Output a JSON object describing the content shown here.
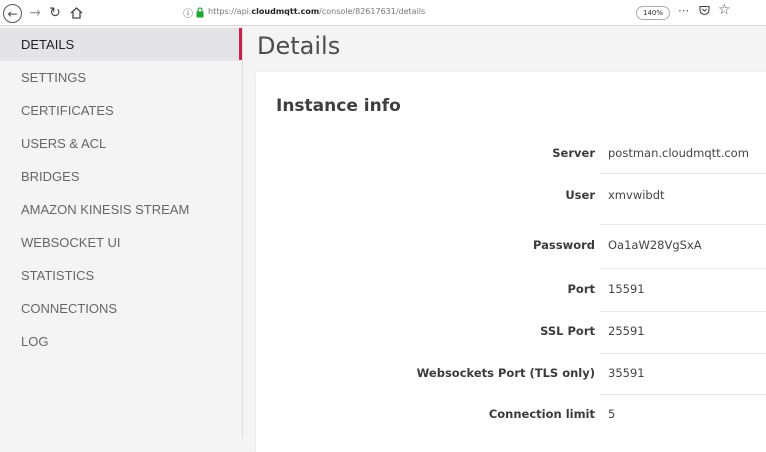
{
  "browser": {
    "url_prefix": "https://api.",
    "url_domain": "cloudmqtt.com",
    "url_path": "/console/82617631/details",
    "zoom": "140%",
    "icons": [
      "back-icon",
      "forward-icon",
      "reload-icon",
      "home-icon",
      "info-icon",
      "lock-icon",
      "more-icon",
      "pocket-icon",
      "star-icon"
    ]
  },
  "sidebar": {
    "items": [
      {
        "label": "DETAILS",
        "active": true
      },
      {
        "label": "SETTINGS"
      },
      {
        "label": "CERTIFICATES"
      },
      {
        "label": "USERS & ACL"
      },
      {
        "label": "BRIDGES"
      },
      {
        "label": "AMAZON KINESIS STREAM"
      },
      {
        "label": "WEBSOCKET UI"
      },
      {
        "label": "STATISTICS"
      },
      {
        "label": "CONNECTIONS"
      },
      {
        "label": "LOG"
      }
    ]
  },
  "colors": {
    "accent": "#c8204b",
    "background": "#f4f4f5",
    "card": "#ffffff"
  },
  "main": {
    "title": "Details",
    "section_title": "Instance info",
    "rows": [
      {
        "label": "Server",
        "value": "postman.cloudmqtt.com"
      },
      {
        "label": "User",
        "value": "xmvwibdt"
      },
      {
        "label": "Password",
        "value": "Oa1aW28VgSxA"
      },
      {
        "label": "Port",
        "value": "15591"
      },
      {
        "label": "SSL Port",
        "value": "25591"
      },
      {
        "label": "Websockets Port (TLS only)",
        "value": "35591"
      },
      {
        "label": "Connection limit",
        "value": "5"
      }
    ]
  }
}
